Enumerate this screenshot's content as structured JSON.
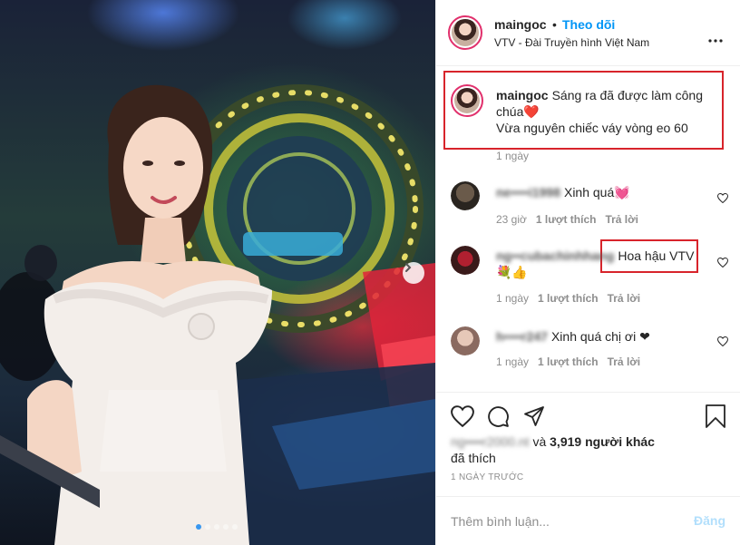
{
  "post": {
    "username": "maingoc",
    "follow_label": "Theo dõi",
    "separator": "•",
    "location": "VTV - Đài Truyền hình Việt Nam",
    "photo_count": 5,
    "active_photo": 1
  },
  "caption": {
    "username": "maingoc",
    "line1": "Sáng ra đã được làm công chúa",
    "emoji": "❤️",
    "line2": "Vừa nguyên chiếc váy vòng eo 60",
    "time": "1 ngày"
  },
  "comments": [
    {
      "username": "ne••••i1998",
      "text": "Xinh quá💓",
      "time": "23 giờ",
      "likes": "1 lượt thích",
      "reply": "Trả lời"
    },
    {
      "username": "ng••cubachinhhang",
      "text": "Hoa hậu VTV",
      "text2": "💐👍",
      "time": "1 ngày",
      "likes": "1 lượt thích",
      "reply": "Trả lời"
    },
    {
      "username": "h••••r247",
      "text": "Xinh quá chị ơi ❤",
      "time": "1 ngày",
      "likes": "1 lượt thích",
      "reply": "Trả lời"
    }
  ],
  "likes": {
    "blurred_user": "ng••••r2000.nt",
    "middle": "và",
    "count": "3,919 người khác",
    "suffix": "đã thích"
  },
  "post_time": "1 NGÀY TRƯỚC",
  "add_comment": {
    "placeholder": "Thêm bình luận...",
    "post_label": "Đăng"
  },
  "icons": [
    "more-icon",
    "heart-icon",
    "comment-icon",
    "share-icon",
    "bookmark-icon",
    "chevron-right-icon"
  ],
  "colors": {
    "link_blue": "#0095f6",
    "highlight_red": "#d8242b",
    "post_disabled": "#b2dffc",
    "muted": "#8e8e8e"
  }
}
